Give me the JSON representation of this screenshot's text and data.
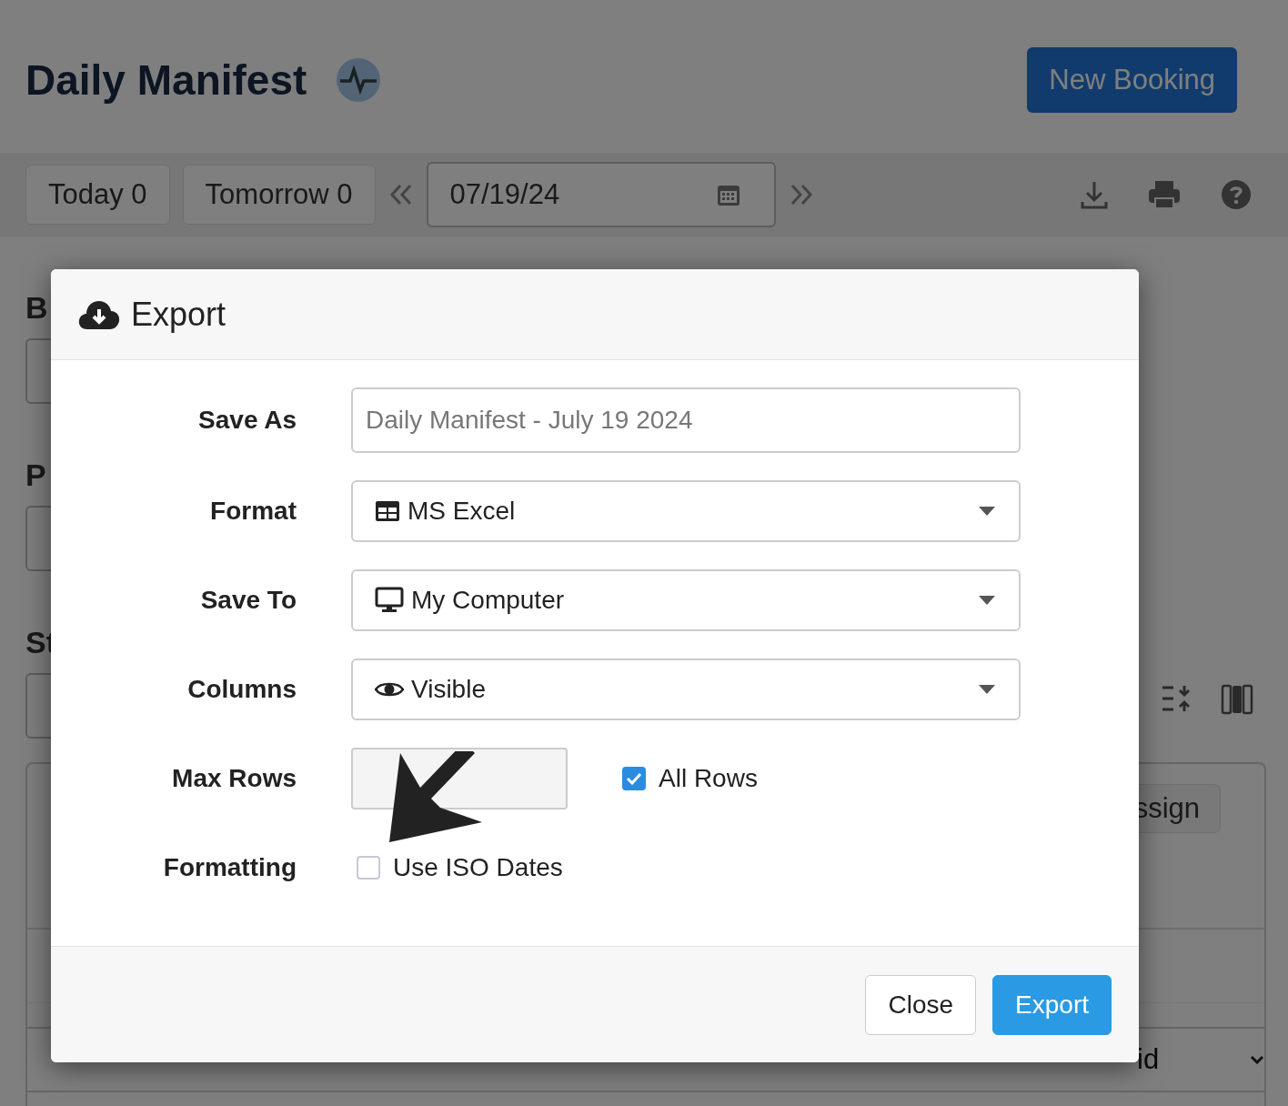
{
  "page": {
    "title": "Daily Manifest",
    "action": "New Booking"
  },
  "toolbar": {
    "quick_dates": [
      {
        "label": "Today 0"
      },
      {
        "label": "Tomorrow 0"
      }
    ],
    "date": "07/19/24"
  },
  "filters": [
    {
      "label": "B"
    },
    {
      "label": "P"
    },
    {
      "label": "St"
    }
  ],
  "panel": {
    "button": "ssign",
    "select": "id"
  },
  "dialog": {
    "title": "Export",
    "fields": [
      {
        "kind": "text",
        "label": "Save As",
        "placeholder": "Daily Manifest - July 19 2024"
      },
      {
        "kind": "select",
        "label": "Format",
        "value": "MS Excel"
      },
      {
        "kind": "select",
        "label": "Save To",
        "value": "My Computer"
      },
      {
        "kind": "select",
        "label": "Columns",
        "value": "Visible"
      },
      {
        "kind": "number",
        "label": "Max Rows",
        "option": {
          "label": "All Rows",
          "checked": true
        }
      },
      {
        "kind": "checkbox",
        "label": "Formatting",
        "option": {
          "label": "Use ISO Dates",
          "checked": false
        }
      }
    ],
    "buttons": [
      {
        "label": "Close",
        "primary": false
      },
      {
        "label": "Export",
        "primary": true
      }
    ]
  }
}
